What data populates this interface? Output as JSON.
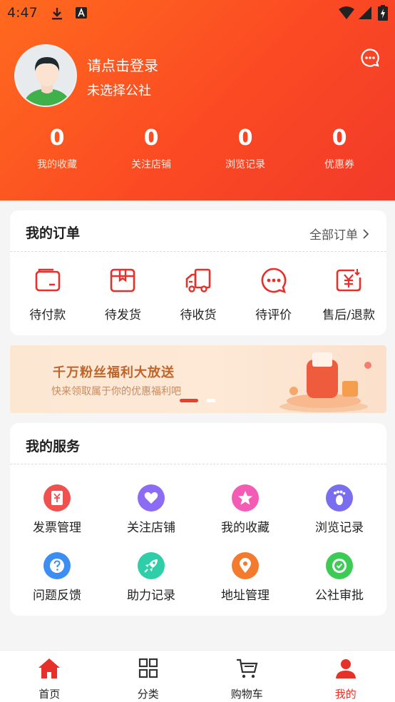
{
  "status_bar": {
    "time": "4:47"
  },
  "profile": {
    "login_prompt": "请点击登录",
    "commune": "未选择公社"
  },
  "stats": [
    {
      "value": "0",
      "label": "我的收藏"
    },
    {
      "value": "0",
      "label": "关注店铺"
    },
    {
      "value": "0",
      "label": "浏览记录"
    },
    {
      "value": "0",
      "label": "优惠券"
    }
  ],
  "orders": {
    "title": "我的订单",
    "all_label": "全部订单",
    "items": [
      {
        "label": "待付款",
        "icon": "wallet-icon"
      },
      {
        "label": "待发货",
        "icon": "package-icon"
      },
      {
        "label": "待收货",
        "icon": "truck-icon"
      },
      {
        "label": "待评价",
        "icon": "comment-icon"
      },
      {
        "label": "售后/退款",
        "icon": "refund-icon"
      }
    ]
  },
  "banner": {
    "title": "千万粉丝福利大放送",
    "subtitle": "快来领取属于你的优惠福利吧"
  },
  "services": {
    "title": "我的服务",
    "items": [
      {
        "label": "发票管理",
        "icon": "invoice-icon",
        "color": "#f0514f"
      },
      {
        "label": "关注店铺",
        "icon": "heart-icon",
        "color": "#8c6cf4"
      },
      {
        "label": "我的收藏",
        "icon": "star-icon",
        "color": "#f45bb5"
      },
      {
        "label": "浏览记录",
        "icon": "footprint-icon",
        "color": "#7a6ef0"
      },
      {
        "label": "问题反馈",
        "icon": "question-icon",
        "color": "#3d8ef2"
      },
      {
        "label": "助力记录",
        "icon": "rocket-icon",
        "color": "#2ecfa8"
      },
      {
        "label": "地址管理",
        "icon": "location-icon",
        "color": "#f47a2e"
      },
      {
        "label": "公社审批",
        "icon": "approve-icon",
        "color": "#3ccb55"
      }
    ]
  },
  "tabbar": [
    {
      "label": "首页",
      "icon": "home-icon"
    },
    {
      "label": "分类",
      "icon": "grid-icon"
    },
    {
      "label": "购物车",
      "icon": "cart-icon"
    },
    {
      "label": "我的",
      "icon": "user-icon",
      "active": true
    }
  ],
  "colors": {
    "accent": "#e8302a",
    "header_start": "#ff6a1e",
    "header_end": "#f23a2a"
  }
}
